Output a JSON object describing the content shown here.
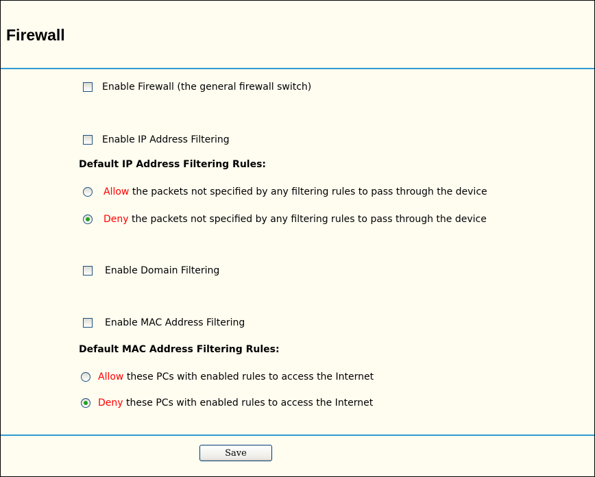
{
  "page": {
    "title": "Firewall",
    "accent_color": "#2c9bd2",
    "highlight_color": "#ff0000"
  },
  "options": {
    "enable_firewall": {
      "label": "Enable Firewall (the general firewall switch)",
      "checked": false
    },
    "enable_ip_filtering": {
      "label": "Enable IP Address Filtering",
      "checked": false
    },
    "ip_rules": {
      "heading": "Default IP Address Filtering Rules:",
      "allow": {
        "keyword": "Allow",
        "text": " the packets not specified by any filtering rules to pass through the device",
        "selected": false
      },
      "deny": {
        "keyword": "Deny",
        "text": " the packets not specified by any filtering rules to pass through the device",
        "selected": true
      }
    },
    "enable_domain_filtering": {
      "label": "Enable Domain Filtering",
      "checked": false
    },
    "enable_mac_filtering": {
      "label": "Enable MAC Address Filtering",
      "checked": false
    },
    "mac_rules": {
      "heading": "Default MAC Address Filtering Rules:",
      "allow": {
        "keyword": "Allow",
        "text": " these PCs with enabled rules to access the Internet",
        "selected": false
      },
      "deny": {
        "keyword": "Deny",
        "text": " these PCs with enabled rules to access the Internet",
        "selected": true
      }
    }
  },
  "actions": {
    "save_label": "Save"
  }
}
